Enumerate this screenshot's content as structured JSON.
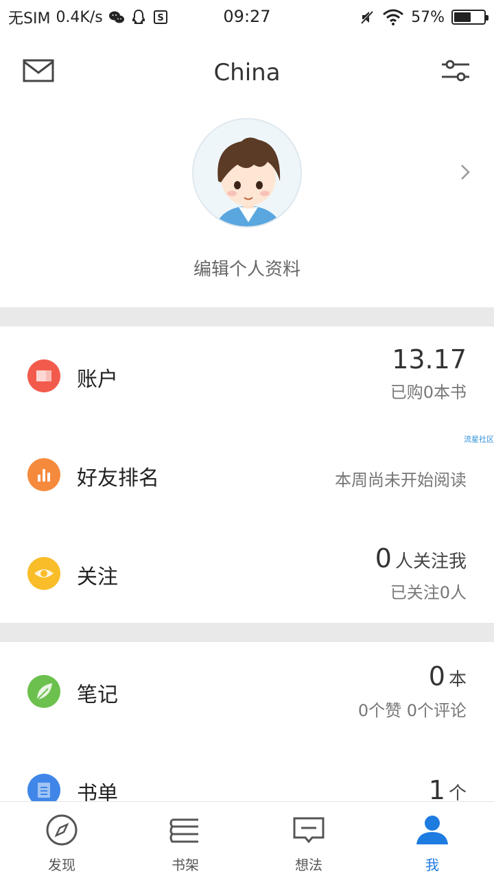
{
  "status_bar": {
    "carrier": "无SIM",
    "speed": "0.4K/s",
    "time": "09:27",
    "battery": "57%",
    "battery_level": 0.57,
    "icons": [
      "wechat-icon",
      "qq-icon",
      "s-app-icon",
      "mute-icon",
      "wifi-icon",
      "battery-icon"
    ]
  },
  "header": {
    "title": "China",
    "left_icon": "mail-icon",
    "right_icon": "filter-sliders-icon"
  },
  "profile": {
    "edit_label": "编辑个人资料",
    "avatar": "cartoon-boy-avatar"
  },
  "rows": {
    "account": {
      "label": "账户",
      "value": "13.17",
      "sub": "已购0本书",
      "icon_color": "#f25b4c"
    },
    "friends_rank": {
      "label": "好友排名",
      "sub": "本周尚未开始阅读",
      "icon_color": "#f58a3c"
    },
    "follow": {
      "label": "关注",
      "value": "0",
      "value_unit": "人关注我",
      "sub": "已关注0人",
      "icon_color": "#f9bd2a"
    },
    "notes": {
      "label": "笔记",
      "value": "0",
      "value_unit": "本",
      "sub": "0个赞 0个评论",
      "icon_color": "#6cc14e"
    },
    "booklist": {
      "label": "书单",
      "value": "1",
      "value_unit": "个",
      "icon_color": "#3f86e8"
    }
  },
  "watermark": "流星社区",
  "bottom_nav": [
    {
      "label": "发现",
      "icon": "compass-icon",
      "active": false
    },
    {
      "label": "书架",
      "icon": "bookshelf-icon",
      "active": false
    },
    {
      "label": "想法",
      "icon": "chat-bubble-icon",
      "active": false
    },
    {
      "label": "我",
      "icon": "person-icon",
      "active": true
    }
  ],
  "colors": {
    "accent": "#1e7be0",
    "divider": "#e9e9ea"
  }
}
